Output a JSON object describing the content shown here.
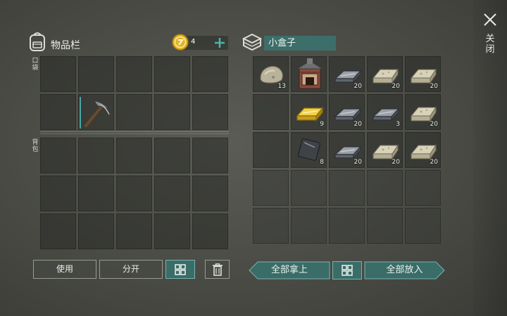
{
  "window": {
    "close_label": "关闭"
  },
  "inventory": {
    "title": "物品栏",
    "quick_slot_label": "口袋",
    "backpack_label": "背包",
    "coins": "4",
    "quick_slots": [
      {
        "item": null
      },
      {
        "item": null
      },
      {
        "item": null
      },
      {
        "item": null
      },
      {
        "item": null
      },
      {
        "item": null
      },
      {
        "item": "pickaxe-icon",
        "selected": true
      },
      {
        "item": null
      },
      {
        "item": null
      },
      {
        "item": null
      }
    ],
    "backpack_slots": 15,
    "buttons": {
      "use": "使用",
      "split": "分开"
    }
  },
  "container": {
    "title": "小盒子",
    "slots": [
      {
        "item": "stone-icon",
        "qty": "13"
      },
      {
        "item": "furnace-icon",
        "qty": ""
      },
      {
        "item": "iron-bar-icon",
        "qty": "20"
      },
      {
        "item": "stone-brick-icon",
        "qty": "20"
      },
      {
        "item": "stone-brick-icon",
        "qty": "20"
      },
      {
        "item": null,
        "qty": ""
      },
      {
        "item": "gold-bar-icon",
        "qty": "9"
      },
      {
        "item": "iron-bar-icon",
        "qty": "20"
      },
      {
        "item": "iron-bar-icon",
        "qty": "3"
      },
      {
        "item": "stone-brick-icon",
        "qty": "20"
      },
      {
        "item": null,
        "qty": ""
      },
      {
        "item": "iron-plate-icon",
        "qty": "8"
      },
      {
        "item": "iron-bar-icon",
        "qty": "20"
      },
      {
        "item": "stone-brick-icon",
        "qty": "20"
      },
      {
        "item": "stone-brick-icon",
        "qty": "20"
      }
    ],
    "buttons": {
      "take_all": "全部拿上",
      "put_all": "全部放入"
    }
  },
  "colors": {
    "accent_teal": "#3c6e6a",
    "accent_teal_light": "#4aa6a4",
    "coin_gold": "#e2b52a"
  }
}
